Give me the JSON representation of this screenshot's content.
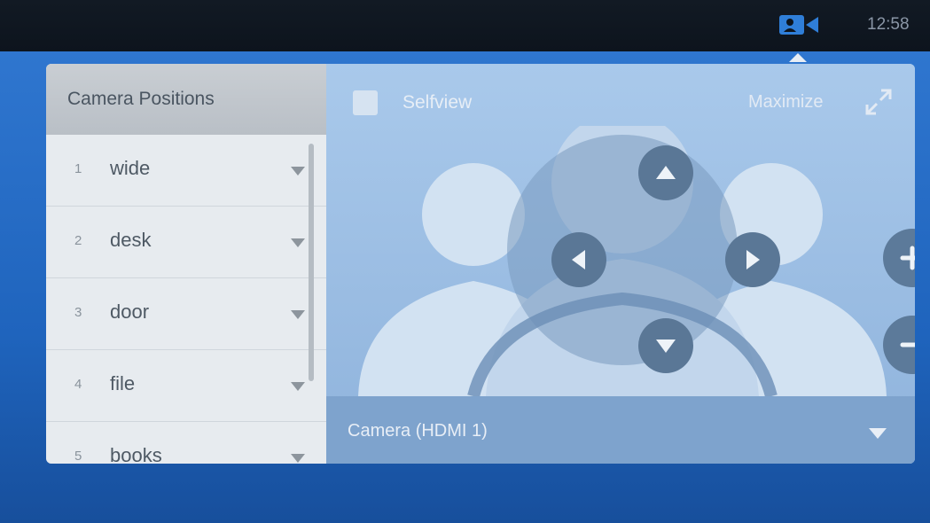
{
  "status_bar": {
    "camera_icon": "video-camera-icon",
    "time": "12:58",
    "accent": "#2f7ed8"
  },
  "positions": {
    "title": "Camera Positions",
    "items": [
      {
        "number": "1",
        "label": "wide"
      },
      {
        "number": "2",
        "label": "desk"
      },
      {
        "number": "3",
        "label": "door"
      },
      {
        "number": "4",
        "label": "file"
      },
      {
        "number": "5",
        "label": "books"
      }
    ]
  },
  "view": {
    "selfview_label": "Selfview",
    "maximize_label": "Maximize",
    "controls": [
      "arrow-up-icon",
      "arrow-down-icon",
      "arrow-left-icon",
      "arrow-right-icon",
      "zoom-in-icon",
      "zoom-out-icon"
    ]
  },
  "source": {
    "selected": "Camera (HDMI 1)"
  }
}
